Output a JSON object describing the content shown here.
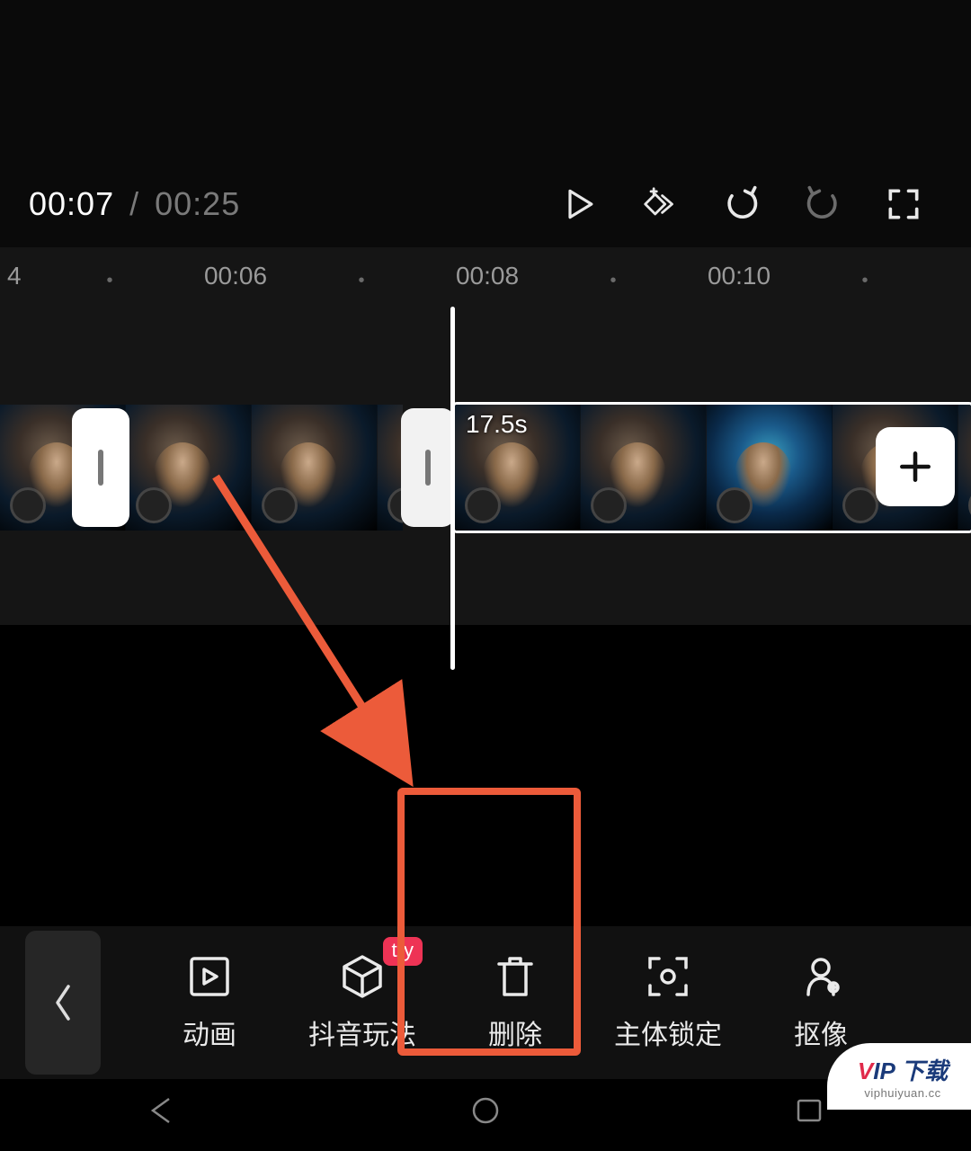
{
  "time": {
    "current": "00:07",
    "total": "00:25",
    "sep": "/"
  },
  "ruler": {
    "edge_left": "4",
    "ticks": [
      "00:06",
      "00:08",
      "00:10"
    ]
  },
  "clip2_duration": "17.5s",
  "toolbar": {
    "back": "返回",
    "items": [
      {
        "label": "动画",
        "icon": "animation"
      },
      {
        "label": "抖音玩法",
        "icon": "cube",
        "badge": "try"
      },
      {
        "label": "删除",
        "icon": "delete"
      },
      {
        "label": "主体锁定",
        "icon": "focus-lock"
      },
      {
        "label": "抠像",
        "icon": "cutout"
      }
    ]
  },
  "watermark": {
    "brand_v": "V",
    "brand_rest": "IP 下载",
    "url": "viphuiyuan.cc"
  }
}
